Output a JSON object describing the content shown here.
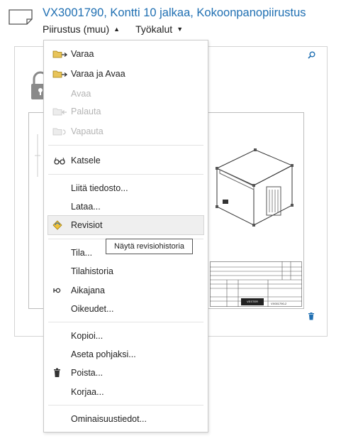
{
  "header": {
    "title": "VX3001790, Kontti 10 jalkaa, Kokoonpanopiirustus",
    "type_menu_label": "Piirustus (muu)",
    "tools_menu_label": "Työkalut",
    "icons": [
      "document-icon",
      "caret-up-icon",
      "caret-down-icon"
    ]
  },
  "preview": {
    "icons": [
      "zoom-icon",
      "lock-icon",
      "trash-icon"
    ],
    "title_block": {
      "logo_text": "VESTER",
      "drawing_no": "VX001790-2"
    }
  },
  "menu": {
    "items": [
      {
        "label": "Varaa",
        "icon": "folder-arrow-icon",
        "enabled": true
      },
      {
        "label": "Varaa ja Avaa",
        "icon": "folder-arrow-icon",
        "enabled": true
      },
      {
        "label": "Avaa",
        "icon": "",
        "enabled": false
      },
      {
        "label": "Palauta",
        "icon": "folder-back-icon",
        "enabled": false
      },
      {
        "label": "Vapauta",
        "icon": "folder-release-icon",
        "enabled": false
      },
      {
        "label": "Katsele",
        "icon": "glasses-icon",
        "enabled": true
      },
      {
        "label": "Liitä tiedosto...",
        "icon": "",
        "enabled": true
      },
      {
        "label": "Lataa...",
        "icon": "",
        "enabled": true
      },
      {
        "label": "Revisiot",
        "icon": "revisions-icon",
        "enabled": true,
        "highlighted": true
      },
      {
        "label": "Tila...",
        "icon": "",
        "enabled": true
      },
      {
        "label": "Tilahistoria",
        "icon": "",
        "enabled": true
      },
      {
        "label": "Aikajana",
        "icon": "timeline-icon",
        "enabled": true
      },
      {
        "label": "Oikeudet...",
        "icon": "",
        "enabled": true
      },
      {
        "label": "Kopioi...",
        "icon": "",
        "enabled": true
      },
      {
        "label": "Aseta pohjaksi...",
        "icon": "",
        "enabled": true
      },
      {
        "label": "Poista...",
        "icon": "trash-icon",
        "enabled": true
      },
      {
        "label": "Korjaa...",
        "icon": "",
        "enabled": true
      },
      {
        "label": "Ominaisuustiedot...",
        "icon": "",
        "enabled": true
      }
    ],
    "tooltip": "Näytä revisiohistoria"
  },
  "colors": {
    "accent": "#1f6fb2",
    "disabled_text": "#b4b4b4",
    "folder": "#e8c45a",
    "highlight_bg": "#efefef"
  }
}
